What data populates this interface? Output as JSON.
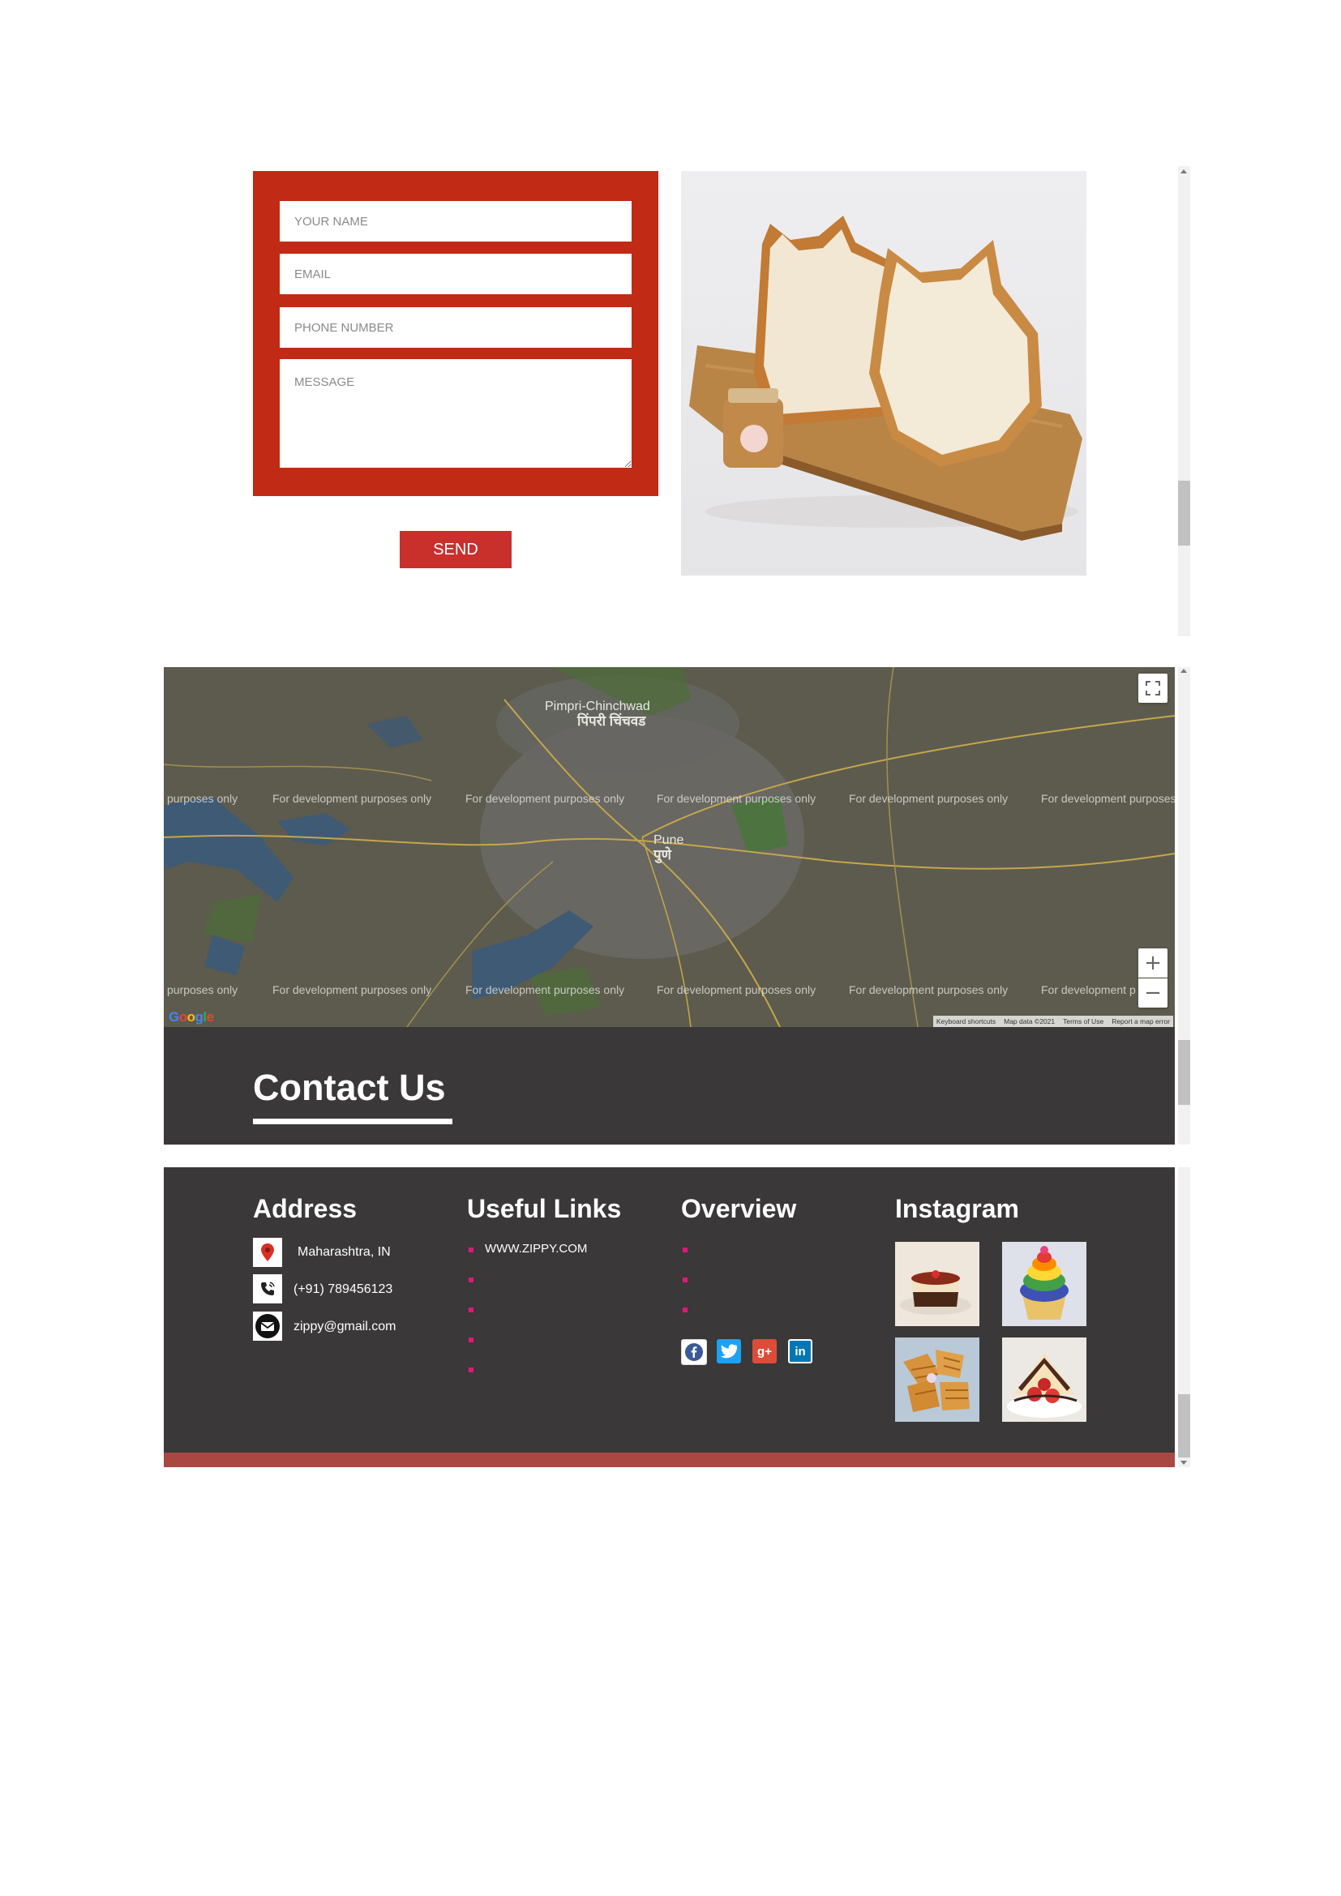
{
  "contact_form": {
    "name_placeholder": "YOUR NAME",
    "email_placeholder": "EMAIL",
    "phone_placeholder": "PHONE NUMBER",
    "message_placeholder": "MESSAGE",
    "send_label": "SEND",
    "panel_color": "#c12a14",
    "button_color": "#c9302c"
  },
  "photo": {
    "icon": "cat-bread-photo"
  },
  "map": {
    "city_labels": [
      {
        "en": "Pimpri-Chinchwad",
        "local": "पिंपरी चिंचवड"
      },
      {
        "en": "Pune",
        "local": "पुणे"
      }
    ],
    "watermark": "For development purposes only",
    "fullscreen_icon": "fullscreen-icon",
    "zoom_in_icon": "zoom-in-icon",
    "zoom_out_icon": "zoom-out-icon",
    "attribution": [
      "Keyboard shortcuts",
      "Map data ©2021",
      "Terms of Use",
      "Report a map error"
    ]
  },
  "contact_banner": {
    "title": "Contact Us"
  },
  "footer": {
    "address": {
      "heading": "Address",
      "location": "Maharashtra, IN",
      "phone": "(+91) 789456123",
      "email": "zippy@gmail.com"
    },
    "useful_links": {
      "heading": "Useful Links",
      "first_link": "WWW.ZIPPY.COM"
    },
    "overview": {
      "heading": "Overview"
    },
    "instagram": {
      "heading": "Instagram",
      "thumbnails": [
        "panna-cotta",
        "rainbow-cupcake",
        "waffles",
        "strawberry-dessert"
      ]
    },
    "social_icons": [
      "facebook-icon",
      "twitter-icon",
      "google-plus-icon",
      "linkedin-icon"
    ],
    "accent_color": "#e0187a",
    "bar_color": "#a94743"
  }
}
